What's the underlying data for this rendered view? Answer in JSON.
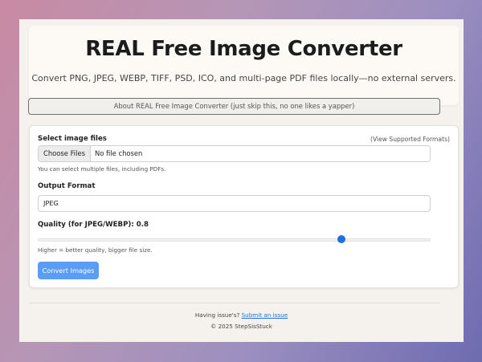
{
  "header": {
    "title": "REAL Free Image Converter",
    "subtitle": "Convert PNG, JPEG, WEBP, TIFF, PSD, ICO, and multi-page PDF files locally—no external servers."
  },
  "about": {
    "label": "About REAL Free Image Converter (just skip this, no one likes a yapper)"
  },
  "form": {
    "files_label": "Select image files",
    "supported_link": "(View Supported Formats)",
    "choose_button": "Choose Files",
    "file_status": "No file chosen",
    "files_hint": "You can select multiple files, including PDFs.",
    "format_label": "Output Format",
    "format_value": "JPEG",
    "quality_label": "Quality (for JPEG/WEBP): 0.8",
    "quality_value": 0.8,
    "quality_hint": "Higher = better quality, bigger file size.",
    "convert_button": "Convert Images"
  },
  "footer": {
    "issue_text": "Having issue's?",
    "issue_link": "Submit an issue",
    "copyright": "© 2025 StepSisStuck"
  },
  "colors": {
    "accent": "#1e6fe0",
    "button": "#5b9cf5"
  }
}
